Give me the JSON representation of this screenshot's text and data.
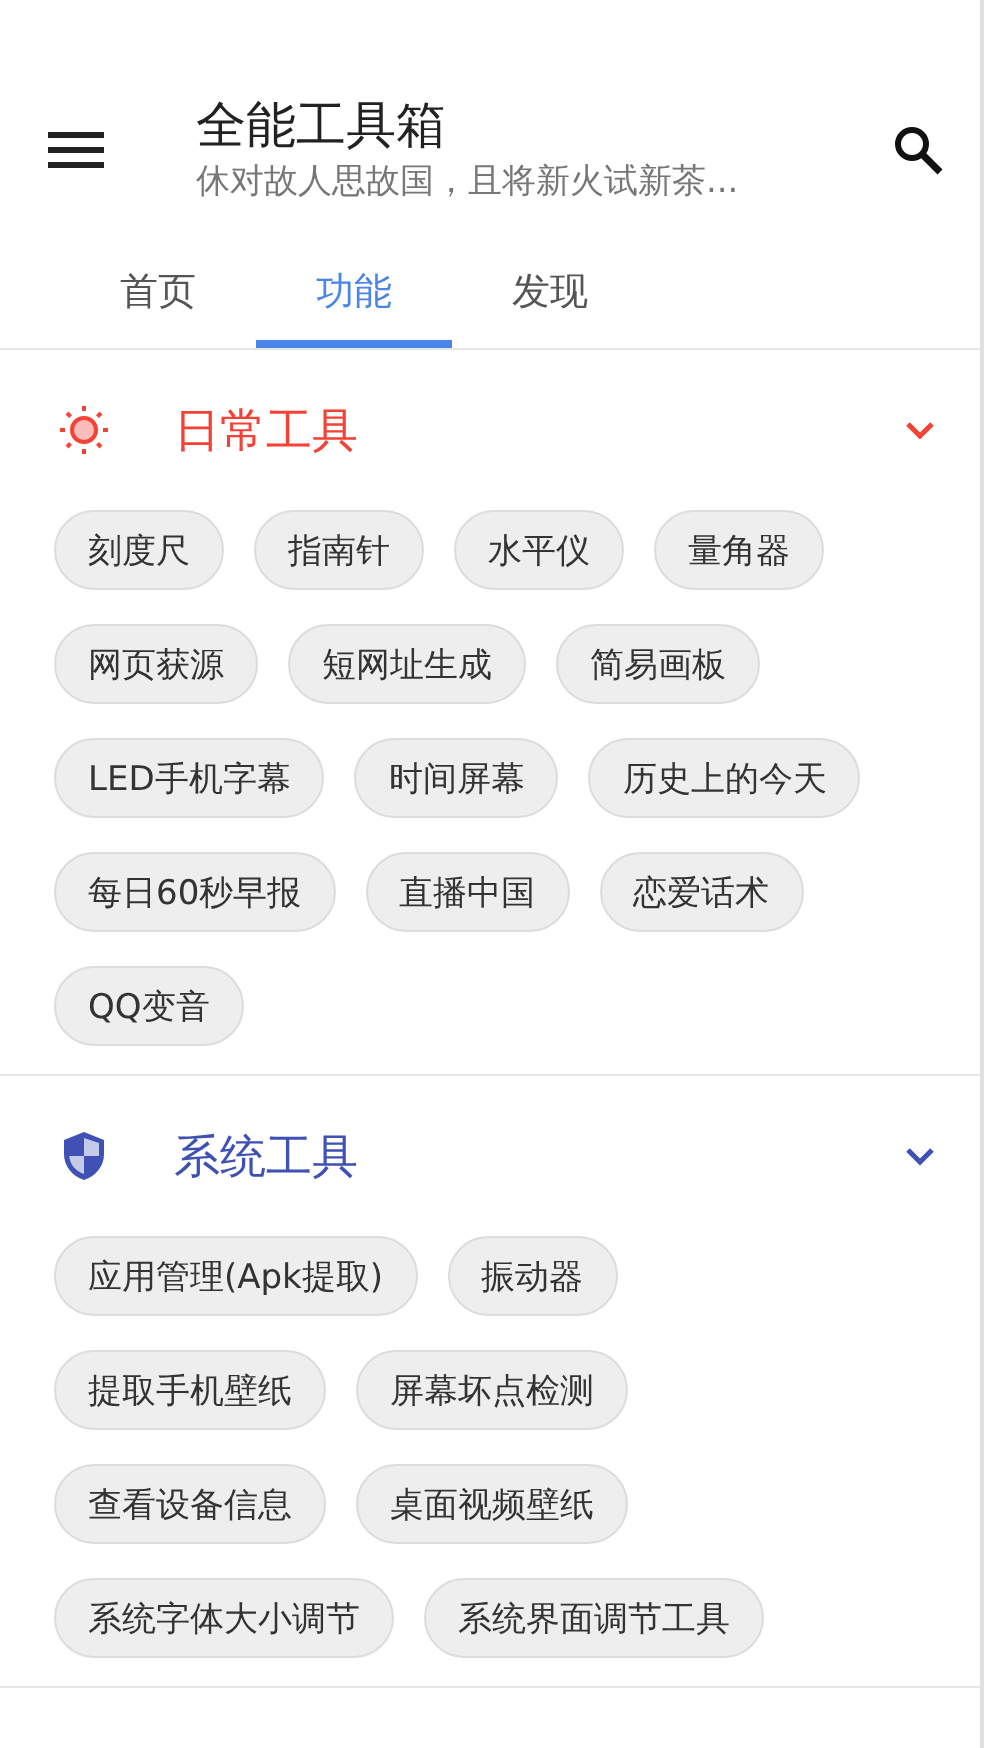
{
  "app_bar": {
    "title": "全能工具箱",
    "subtitle": "休对故人思故国，且将新火试新茶..."
  },
  "tabs": [
    {
      "label": "首页",
      "selected": false
    },
    {
      "label": "功能",
      "selected": true
    },
    {
      "label": "发现",
      "selected": false
    }
  ],
  "sections": [
    {
      "title": "日常工具",
      "kind": "sun",
      "color": "#f44336",
      "expanded": true,
      "tools": [
        "刻度尺",
        "指南针",
        "水平仪",
        "量角器",
        "网页获源",
        "短网址生成",
        "简易画板",
        "LED手机字幕",
        "时间屏幕",
        "历史上的今天",
        "每日60秒早报",
        "直播中国",
        "恋爱话术",
        "QQ变音"
      ]
    },
    {
      "title": "系统工具",
      "kind": "shield",
      "color": "#3f51b5",
      "expanded": true,
      "tools": [
        "应用管理(Apk提取)",
        "振动器",
        "提取手机壁纸",
        "屏幕坏点检测",
        "查看设备信息",
        "桌面视频壁纸",
        "系统字体大小调节",
        "系统界面调节工具"
      ]
    }
  ]
}
